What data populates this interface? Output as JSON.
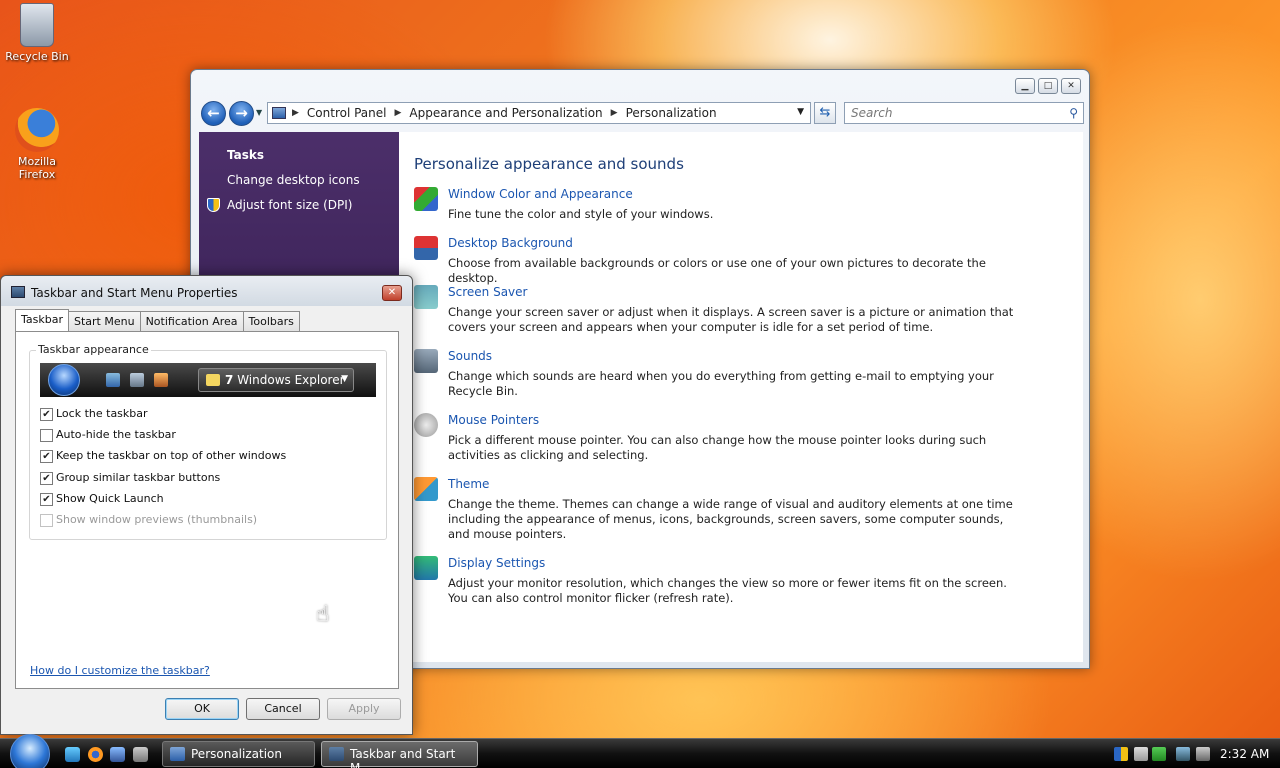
{
  "desktop": {
    "icons": [
      {
        "label": "Recycle Bin",
        "icon": "recycle-bin-icon"
      },
      {
        "label": "Mozilla Firefox",
        "icon": "firefox-icon"
      }
    ]
  },
  "control_panel": {
    "window_buttons": {
      "minimize": "▁",
      "maximize": "□",
      "close": "✕"
    },
    "nav": {
      "back": "←",
      "forward": "→"
    },
    "breadcrumbs": [
      "Control Panel",
      "Appearance and Personalization",
      "Personalization"
    ],
    "search_placeholder": "Search",
    "sidebar": {
      "title": "Tasks",
      "links": [
        "Change desktop icons",
        "Adjust font size (DPI)"
      ]
    },
    "heading": "Personalize appearance and sounds",
    "items": [
      {
        "title": "Window Color and Appearance",
        "desc": "Fine tune the color and style of your windows.",
        "icon": "window-color-icon"
      },
      {
        "title": "Desktop Background",
        "desc": "Choose from available backgrounds or colors or use one of your own pictures to decorate the desktop.",
        "icon": "desktop-background-icon"
      },
      {
        "title": "Screen Saver",
        "desc": "Change your screen saver or adjust when it displays. A screen saver is a picture or animation that covers your screen and appears when your computer is idle for a set period of time.",
        "icon": "screen-saver-icon"
      },
      {
        "title": "Sounds",
        "desc": "Change which sounds are heard when you do everything from getting e-mail to emptying your Recycle Bin.",
        "icon": "sounds-icon"
      },
      {
        "title": "Mouse Pointers",
        "desc": "Pick a different mouse pointer. You can also change how the mouse pointer looks during such activities as clicking and selecting.",
        "icon": "mouse-pointer-icon"
      },
      {
        "title": "Theme",
        "desc": "Change the theme. Themes can change a wide range of visual and auditory elements at one time including the appearance of menus, icons, backgrounds, screen savers, some computer sounds, and mouse pointers.",
        "icon": "theme-icon"
      },
      {
        "title": "Display Settings",
        "desc": "Adjust your monitor resolution, which changes the view so more or fewer items fit on the screen. You can also control monitor flicker (refresh rate).",
        "icon": "display-settings-icon"
      }
    ]
  },
  "dialog": {
    "title": "Taskbar and Start Menu Properties",
    "tabs": [
      "Taskbar",
      "Start Menu",
      "Notification Area",
      "Toolbars"
    ],
    "group_label": "Taskbar appearance",
    "preview": {
      "button_count": "7",
      "button_label": "Windows Explorer"
    },
    "checkboxes": [
      {
        "label": "Lock the taskbar",
        "checked": true,
        "enabled": true
      },
      {
        "label": "Auto-hide the taskbar",
        "checked": false,
        "enabled": true
      },
      {
        "label": "Keep the taskbar on top of other windows",
        "checked": true,
        "enabled": true
      },
      {
        "label": "Group similar taskbar buttons",
        "checked": true,
        "enabled": true
      },
      {
        "label": "Show Quick Launch",
        "checked": true,
        "enabled": true
      },
      {
        "label": "Show window previews (thumbnails)",
        "checked": false,
        "enabled": false
      }
    ],
    "help_link": "How do I customize the taskbar?",
    "buttons": {
      "ok": "OK",
      "cancel": "Cancel",
      "apply": "Apply"
    }
  },
  "taskbar": {
    "tasks": [
      {
        "label": "Personalization",
        "active": false
      },
      {
        "label": "Taskbar and Start M...",
        "active": true
      }
    ],
    "clock": "2:32 AM"
  }
}
